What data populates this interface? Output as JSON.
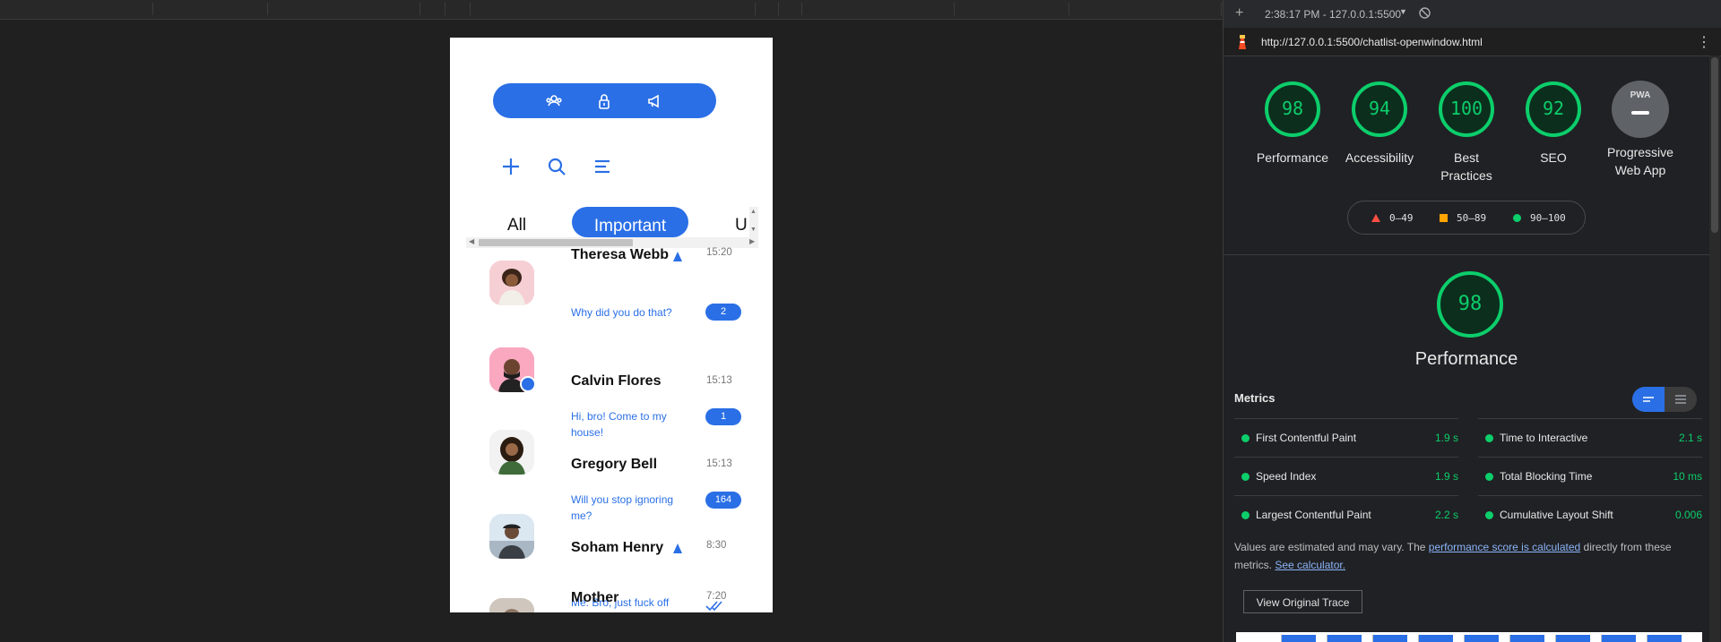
{
  "devtools": {
    "session": "2:38:17 PM - 127.0.0.1:5500",
    "url": "http://127.0.0.1:5500/chatlist-openwindow.html"
  },
  "app": {
    "tabs": [
      "All",
      "Important",
      "U"
    ],
    "chats": [
      {
        "name": "Theresa Webb",
        "preview": "Why did you do that?",
        "time": "15:20",
        "badge": "2",
        "bell": true
      },
      {
        "name": "Calvin Flores",
        "preview": "Hi, bro! Come to my house!",
        "time": "15:13",
        "badge": "1",
        "online": true
      },
      {
        "name": "Gregory Bell",
        "preview": "Will you stop ignoring me?",
        "time": "15:13",
        "badge": "164"
      },
      {
        "name": "Soham Henry",
        "preview": "Me: Bro, just fuck off",
        "time": "8:30",
        "bell": true,
        "read": true
      },
      {
        "name": "Mother",
        "time": "7:20"
      }
    ]
  },
  "lighthouse": {
    "scores": [
      {
        "label": "Performance",
        "value": "98"
      },
      {
        "label": "Accessibility",
        "value": "94"
      },
      {
        "label": "Best Practices",
        "value": "100"
      },
      {
        "label": "SEO",
        "value": "92"
      },
      {
        "label": "Progressive Web App",
        "value": "PWA"
      }
    ],
    "legend": [
      "0–49",
      "50–89",
      "90–100"
    ],
    "main_score": "98",
    "main_title": "Performance",
    "metrics_title": "Metrics",
    "metrics_left": [
      {
        "name": "First Contentful Paint",
        "value": "1.9 s"
      },
      {
        "name": "Speed Index",
        "value": "1.9 s"
      },
      {
        "name": "Largest Contentful Paint",
        "value": "2.2 s"
      }
    ],
    "metrics_right": [
      {
        "name": "Time to Interactive",
        "value": "2.1 s"
      },
      {
        "name": "Total Blocking Time",
        "value": "10 ms"
      },
      {
        "name": "Cumulative Layout Shift",
        "value": "0.006"
      }
    ],
    "note_pre": "Values are estimated and may vary. The ",
    "note_link1": "performance score is calculated",
    "note_mid": " directly from these metrics. ",
    "note_link2": "See calculator.",
    "trace_button": "View Original Trace"
  },
  "colors": {
    "accent": "#2a6fe6",
    "good": "#0cce6b"
  }
}
